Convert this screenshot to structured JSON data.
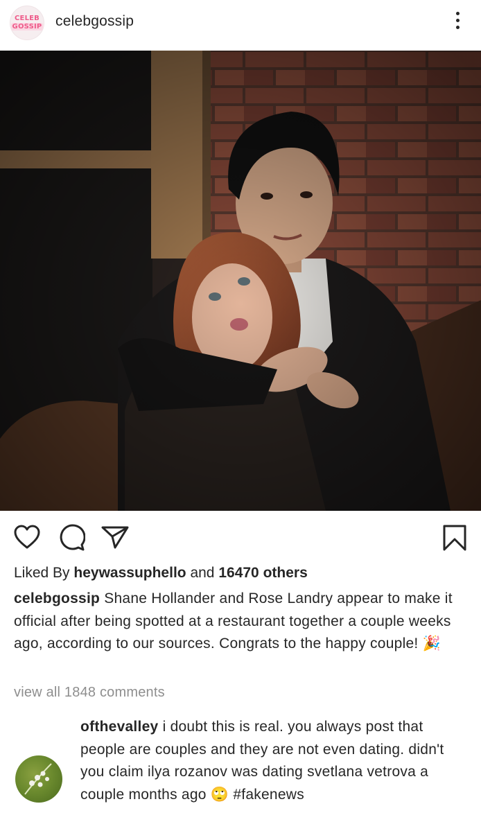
{
  "post": {
    "username": "celebgossip",
    "avatar_line1": "CELEB",
    "avatar_line2": "GOSSIP",
    "photo_description": "",
    "likes": {
      "prefix": "Liked By",
      "first_liker": "heywassuphello",
      "and": "and",
      "others": "16470 others"
    },
    "caption": {
      "username": "celebgossip",
      "text": "Shane Hollander and Rose Landry appear to make it official after being spotted at a restaurant together a couple weeks ago, according to our sources. Congrats to the happy couple!",
      "emoji": "🎉"
    },
    "view_all_comments": "view all 1848 comments",
    "comments": [
      {
        "username": "ofthevalley",
        "text": "i doubt this is real. you always post that people are couples and they are not even dating. didn't you claim ilya rozanov was dating svetlana vetrova a couple months ago",
        "emoji": "🙄",
        "hashtag": "#fakenews"
      }
    ]
  },
  "icons": {
    "more": "more-vertical-icon",
    "like": "heart-icon",
    "comment": "comment-icon",
    "share": "send-icon",
    "save": "bookmark-icon"
  },
  "colors": {
    "text": "#262626",
    "muted": "#8e8e8e",
    "brand_pink": "#ee5b8a"
  }
}
